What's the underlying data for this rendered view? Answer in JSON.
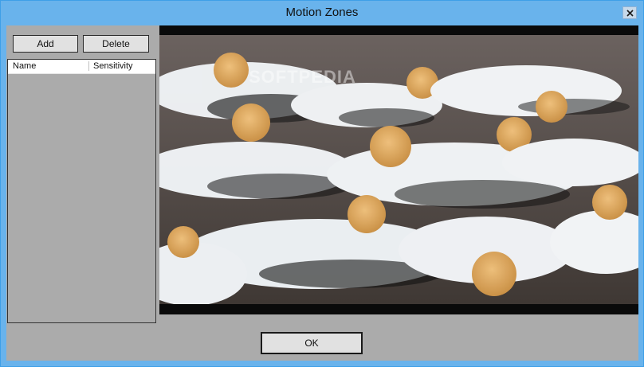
{
  "window": {
    "title": "Motion Zones"
  },
  "toolbar": {
    "add_label": "Add",
    "delete_label": "Delete"
  },
  "list": {
    "columns": [
      "Name",
      "Sensitivity"
    ],
    "rows": []
  },
  "footer": {
    "ok_label": "OK"
  },
  "watermark": "SOFTPEDIA",
  "icons": {
    "close": "close-icon"
  },
  "colors": {
    "titlebar": "#69b3ec",
    "client_bg": "#ababab",
    "button_bg": "#e1e1e1"
  }
}
